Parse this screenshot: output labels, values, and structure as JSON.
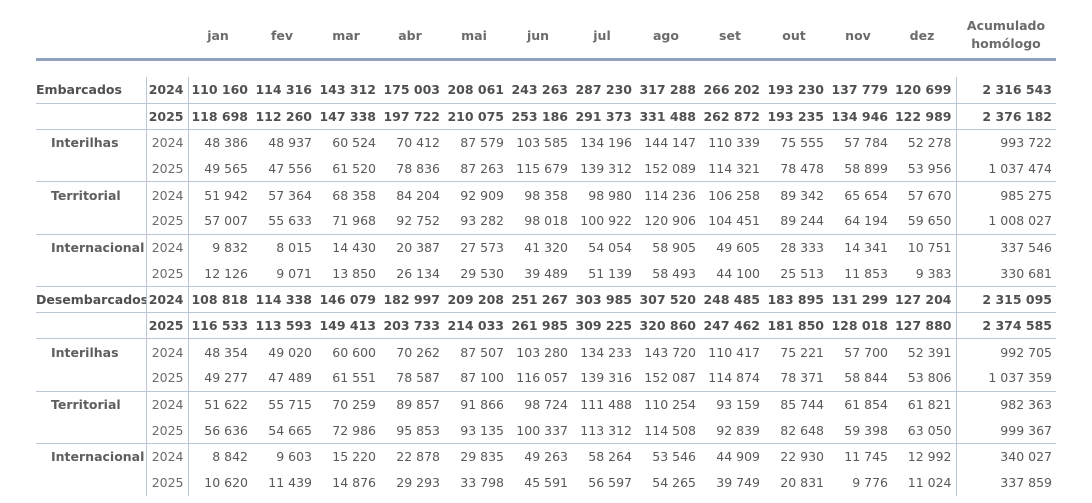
{
  "header": {
    "year_col": "",
    "months": [
      "jan",
      "fev",
      "mar",
      "abr",
      "mai",
      "jun",
      "jul",
      "ago",
      "set",
      "out",
      "nov",
      "dez"
    ],
    "acc_line1": "Acumulado",
    "acc_line2": "homólogo"
  },
  "rows": [
    {
      "label": "Embarcados",
      "year": "2024",
      "bold": true,
      "sub": false,
      "sep": true,
      "m": [
        "110 160",
        "114 316",
        "143 312",
        "175 003",
        "208 061",
        "243 263",
        "287 230",
        "317 288",
        "266 202",
        "193 230",
        "137 779",
        "120 699"
      ],
      "acc": "2 316 543"
    },
    {
      "label": "",
      "year": "2025",
      "bold": true,
      "sub": false,
      "sep": true,
      "m": [
        "118 698",
        "112 260",
        "147 338",
        "197 722",
        "210 075",
        "253 186",
        "291 373",
        "331 488",
        "262 872",
        "193 235",
        "134 946",
        "122 989"
      ],
      "acc": "2 376 182"
    },
    {
      "label": "Interilhas",
      "year": "2024",
      "bold": false,
      "sub": true,
      "sep": false,
      "m": [
        "48 386",
        "48 937",
        "60 524",
        "70 412",
        "87 579",
        "103 585",
        "134 196",
        "144 147",
        "110 339",
        "75 555",
        "57 784",
        "52 278"
      ],
      "acc": "993 722"
    },
    {
      "label": "",
      "year": "2025",
      "bold": false,
      "sub": true,
      "sep": true,
      "m": [
        "49 565",
        "47 556",
        "61 520",
        "78 836",
        "87 263",
        "115 679",
        "139 312",
        "152 089",
        "114 321",
        "78 478",
        "58 899",
        "53 956"
      ],
      "acc": "1 037 474"
    },
    {
      "label": "Territorial",
      "year": "2024",
      "bold": false,
      "sub": true,
      "sep": false,
      "m": [
        "51 942",
        "57 364",
        "68 358",
        "84 204",
        "92 909",
        "98 358",
        "98 980",
        "114 236",
        "106 258",
        "89 342",
        "65 654",
        "57 670"
      ],
      "acc": "985 275"
    },
    {
      "label": "",
      "year": "2025",
      "bold": false,
      "sub": true,
      "sep": true,
      "m": [
        "57 007",
        "55 633",
        "71 968",
        "92 752",
        "93 282",
        "98 018",
        "100 922",
        "120 906",
        "104 451",
        "89 244",
        "64 194",
        "59 650"
      ],
      "acc": "1 008 027"
    },
    {
      "label": "Internacional",
      "year": "2024",
      "bold": false,
      "sub": true,
      "sep": false,
      "m": [
        "9 832",
        "8 015",
        "14 430",
        "20 387",
        "27 573",
        "41 320",
        "54 054",
        "58 905",
        "49 605",
        "28 333",
        "14 341",
        "10 751"
      ],
      "acc": "337 546"
    },
    {
      "label": "",
      "year": "2025",
      "bold": false,
      "sub": true,
      "sep": true,
      "m": [
        "12 126",
        "9 071",
        "13 850",
        "26 134",
        "29 530",
        "39 489",
        "51 139",
        "58 493",
        "44 100",
        "25 513",
        "11 853",
        "9 383"
      ],
      "acc": "330 681"
    },
    {
      "label": "Desembarcados",
      "year": "2024",
      "bold": true,
      "sub": false,
      "sep": true,
      "m": [
        "108 818",
        "114 338",
        "146 079",
        "182 997",
        "209 208",
        "251 267",
        "303 985",
        "307 520",
        "248 485",
        "183 895",
        "131 299",
        "127 204"
      ],
      "acc": "2 315 095"
    },
    {
      "label": "",
      "year": "2025",
      "bold": true,
      "sub": false,
      "sep": true,
      "m": [
        "116 533",
        "113 593",
        "149 413",
        "203 733",
        "214 033",
        "261 985",
        "309 225",
        "320 860",
        "247 462",
        "181 850",
        "128 018",
        "127 880"
      ],
      "acc": "2 374 585"
    },
    {
      "label": "Interilhas",
      "year": "2024",
      "bold": false,
      "sub": true,
      "sep": false,
      "m": [
        "48 354",
        "49 020",
        "60 600",
        "70 262",
        "87 507",
        "103 280",
        "134 233",
        "143 720",
        "110 417",
        "75 221",
        "57 700",
        "52 391"
      ],
      "acc": "992 705"
    },
    {
      "label": "",
      "year": "2025",
      "bold": false,
      "sub": true,
      "sep": true,
      "m": [
        "49 277",
        "47 489",
        "61 551",
        "78 587",
        "87 100",
        "116 057",
        "139 316",
        "152 087",
        "114 874",
        "78 371",
        "58 844",
        "53 806"
      ],
      "acc": "1 037 359"
    },
    {
      "label": "Territorial",
      "year": "2024",
      "bold": false,
      "sub": true,
      "sep": false,
      "m": [
        "51 622",
        "55 715",
        "70 259",
        "89 857",
        "91 866",
        "98 724",
        "111 488",
        "110 254",
        "93 159",
        "85 744",
        "61 854",
        "61 821"
      ],
      "acc": "982 363"
    },
    {
      "label": "",
      "year": "2025",
      "bold": false,
      "sub": true,
      "sep": true,
      "m": [
        "56 636",
        "54 665",
        "72 986",
        "95 853",
        "93 135",
        "100 337",
        "113 312",
        "114 508",
        "92 839",
        "82 648",
        "59 398",
        "63 050"
      ],
      "acc": "999 367"
    },
    {
      "label": "Internacional",
      "year": "2024",
      "bold": false,
      "sub": true,
      "sep": false,
      "m": [
        "8 842",
        "9 603",
        "15 220",
        "22 878",
        "29 835",
        "49 263",
        "58 264",
        "53 546",
        "44 909",
        "22 930",
        "11 745",
        "12 992"
      ],
      "acc": "340 027"
    },
    {
      "label": "",
      "year": "2025",
      "bold": false,
      "sub": true,
      "sep": false,
      "m": [
        "10 620",
        "11 439",
        "14 876",
        "29 293",
        "33 798",
        "45 591",
        "56 597",
        "54 265",
        "39 749",
        "20 831",
        "9 776",
        "11 024"
      ],
      "acc": "337 859"
    }
  ]
}
